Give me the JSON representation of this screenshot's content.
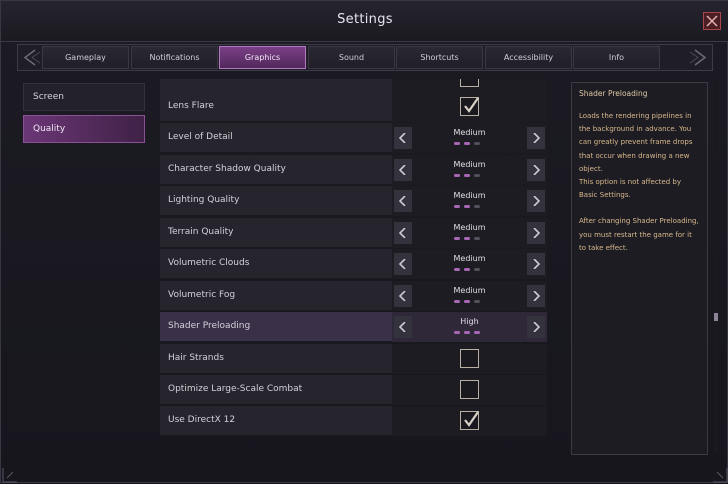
{
  "window": {
    "title": "Settings",
    "close_icon": "close-x-icon"
  },
  "tabs": [
    {
      "label": "Gameplay",
      "active": false
    },
    {
      "label": "Notifications",
      "active": false
    },
    {
      "label": "Graphics",
      "active": true
    },
    {
      "label": "Sound",
      "active": false
    },
    {
      "label": "Shortcuts",
      "active": false
    },
    {
      "label": "Accessibility",
      "active": false
    },
    {
      "label": "Info",
      "active": false
    }
  ],
  "sidebar": {
    "items": [
      {
        "label": "Screen",
        "active": false
      },
      {
        "label": "Quality",
        "active": true
      }
    ]
  },
  "settings": [
    {
      "label": "Lens Flare",
      "type": "checkbox",
      "checked": true
    },
    {
      "label": "Level of Detail",
      "type": "select",
      "value": "Medium",
      "level": 2,
      "levels": 3
    },
    {
      "label": "Character Shadow Quality",
      "type": "select",
      "value": "Medium",
      "level": 2,
      "levels": 3
    },
    {
      "label": "Lighting Quality",
      "type": "select",
      "value": "Medium",
      "level": 2,
      "levels": 3
    },
    {
      "label": "Terrain Quality",
      "type": "select",
      "value": "Medium",
      "level": 2,
      "levels": 3
    },
    {
      "label": "Volumetric Clouds",
      "type": "select",
      "value": "Medium",
      "level": 2,
      "levels": 3
    },
    {
      "label": "Volumetric Fog",
      "type": "select",
      "value": "Medium",
      "level": 2,
      "levels": 3
    },
    {
      "label": "Shader Preloading",
      "type": "select",
      "value": "High",
      "level": 3,
      "levels": 3,
      "highlighted": true
    },
    {
      "label": "Hair Strands",
      "type": "checkbox",
      "checked": false
    },
    {
      "label": "Optimize Large-Scale Combat",
      "type": "checkbox",
      "checked": false
    },
    {
      "label": "Use DirectX 12",
      "type": "checkbox",
      "checked": true
    }
  ],
  "info_panel": {
    "title": "Shader Preloading",
    "paragraphs": [
      "Loads the rendering pipelines in the background in advance. You can greatly prevent frame drops that occur when drawing a new object.",
      "This option is not affected by Basic Settings.",
      "",
      "After changing Shader Preloading, you must restart the game for it to take effect."
    ]
  },
  "colors": {
    "accent": "#7a3f86",
    "accent_border": "#b37cc0",
    "dot_on": "#a867b5",
    "info_text": "#d9b88c",
    "close": "#a9484c"
  }
}
